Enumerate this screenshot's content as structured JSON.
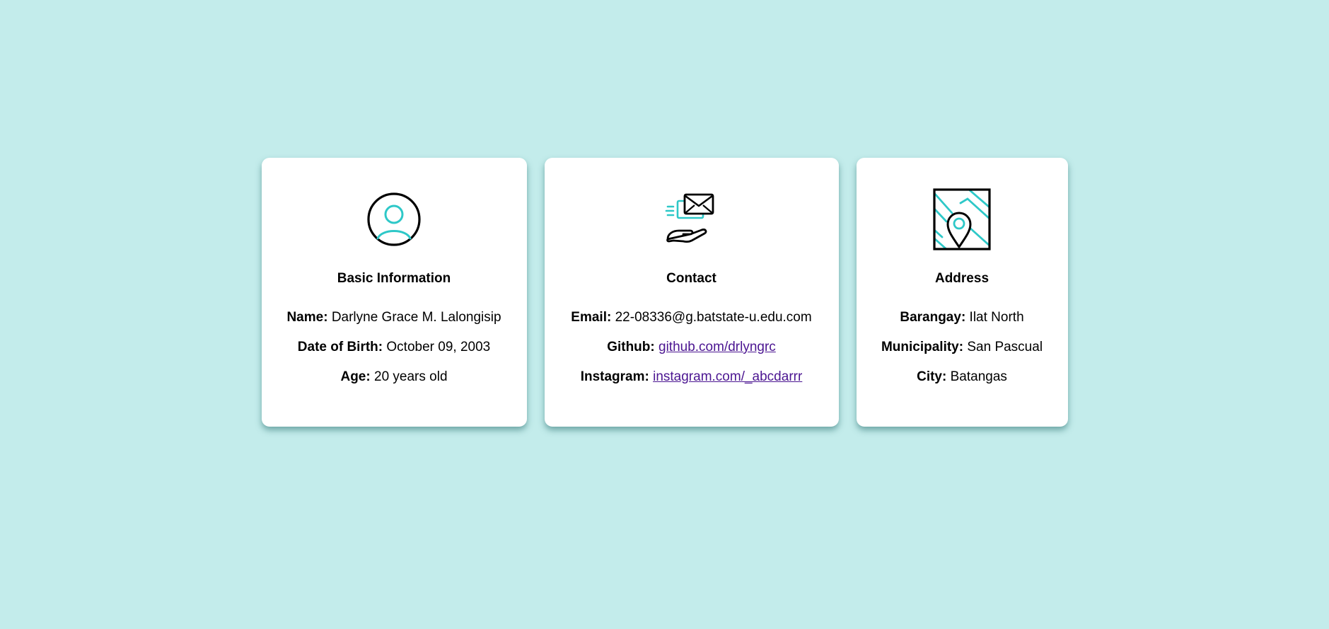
{
  "colors": {
    "background": "#c3eceb",
    "accent": "#2ec8c8",
    "link": "#4b1591"
  },
  "cards": [
    {
      "icon": "user-circle-icon",
      "title": "Basic Information",
      "rows": [
        {
          "label": "Name:",
          "value": "Darlyne Grace M. Lalongisip"
        },
        {
          "label": "Date of Birth:",
          "value": "October 09, 2003"
        },
        {
          "label": "Age:",
          "value": "20 years old"
        }
      ]
    },
    {
      "icon": "hand-mail-icon",
      "title": "Contact",
      "rows": [
        {
          "label": "Email:",
          "value": "22-08336@g.batstate-u.edu.com"
        },
        {
          "label": "Github:",
          "value": "github.com/drlyngrc"
        },
        {
          "label": "Instagram:",
          "value": "instagram.com/_abcdarrr"
        }
      ]
    },
    {
      "icon": "map-pin-icon",
      "title": "Address",
      "rows": [
        {
          "label": "Barangay:",
          "value": "Ilat North"
        },
        {
          "label": "Municipality:",
          "value": "San Pascual"
        },
        {
          "label": "City:",
          "value": "Batangas"
        }
      ]
    }
  ]
}
